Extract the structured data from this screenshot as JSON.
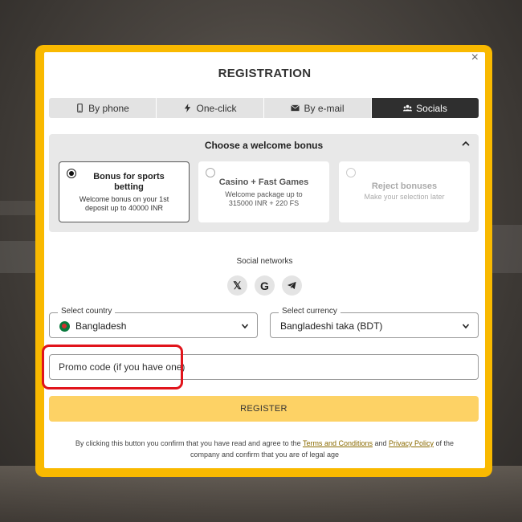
{
  "modal": {
    "title": "REGISTRATION",
    "close_icon": "close-icon",
    "accent_color": "#f9b900"
  },
  "tabs": [
    {
      "label": "By phone",
      "icon": "phone-icon"
    },
    {
      "label": "One-click",
      "icon": "lightning-icon"
    },
    {
      "label": "By e-mail",
      "icon": "envelope-icon"
    },
    {
      "label": "Socials",
      "icon": "users-icon",
      "active": true
    }
  ],
  "bonus": {
    "heading": "Choose a welcome bonus",
    "options": [
      {
        "title": "Bonus for sports betting",
        "desc": "Welcome bonus on your 1st deposit up to 40000 INR",
        "selected": true
      },
      {
        "title": "Casino + Fast Games",
        "desc": "Welcome package up to 315000 INR + 220 FS",
        "selected": false
      },
      {
        "title": "Reject bonuses",
        "desc": "Make your selection later",
        "selected": false
      }
    ]
  },
  "social": {
    "label": "Social networks",
    "icons": [
      "x-icon",
      "google-icon",
      "telegram-icon"
    ],
    "glyphs": {
      "x": "𝕏",
      "google": "G"
    }
  },
  "country": {
    "legend": "Select country",
    "value": "Bangladesh"
  },
  "currency": {
    "legend": "Select currency",
    "value": "Bangladeshi taka (BDT)"
  },
  "promo": {
    "placeholder": "Promo code (if you have one)"
  },
  "register": {
    "label": "REGISTER",
    "color": "#fdd265"
  },
  "terms": {
    "before": "By clicking this button you confirm that you have read and agree to the ",
    "link1": "Terms and Conditions",
    "middle": " and ",
    "link2": "Privacy Policy",
    "after": " of the company and confirm that you are of legal age"
  }
}
